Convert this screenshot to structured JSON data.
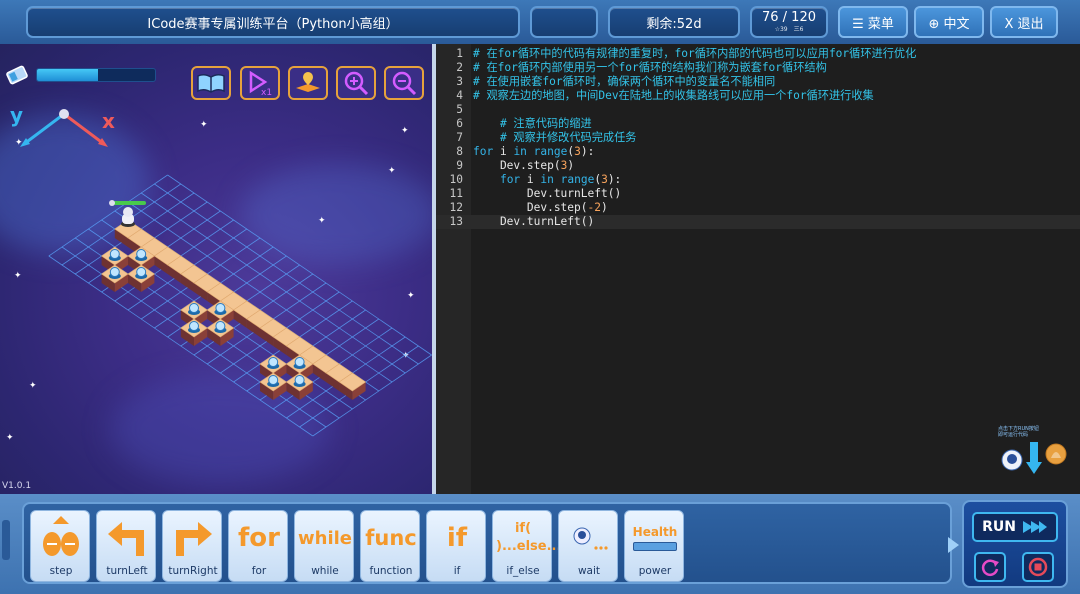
{
  "header": {
    "title": "ICode赛事专属训练平台（Python小高组）",
    "remaining": "剩余:52d",
    "progress": "76 / 120",
    "progress_sub_a": "☆39",
    "progress_sub_b": "三6",
    "menu_label": "☰ 菜单",
    "lang_label": "⊕ 中文",
    "exit_label": "X 退出"
  },
  "scene": {
    "axis_y": "y",
    "axis_x": "x",
    "version": "V1.0.1",
    "energy_level": 0.52,
    "tools": [
      "book-icon",
      "replay-x1-icon",
      "map-icon",
      "zoom-in-icon",
      "zoom-out-icon"
    ]
  },
  "editor": {
    "lines": [
      {
        "n": "1",
        "text": "# 在for循环中的代码有规律的重复时，for循环内部的代码也可以应用for循环进行优化"
      },
      {
        "n": "2",
        "text": "# 在for循环内部使用另一个for循环的结构我们称为嵌套for循环结构"
      },
      {
        "n": "3",
        "text": "# 在使用嵌套for循环时，确保两个循环中的变量名不能相同"
      },
      {
        "n": "4",
        "text": "# 观察左边的地图，中间Dev在陆地上的收集路线可以应用一个for循环进行收集"
      },
      {
        "n": "5",
        "text": ""
      },
      {
        "n": "6",
        "text": "    # 注意代码的缩进"
      },
      {
        "n": "7",
        "text": "    # 观察并修改代码完成任务"
      },
      {
        "n": "8",
        "text": "for i in range(3):"
      },
      {
        "n": "9",
        "text": "    Dev.step(3)"
      },
      {
        "n": "10",
        "text": "    for i in range(3):"
      },
      {
        "n": "11",
        "text": "        Dev.turnLeft()"
      },
      {
        "n": "12",
        "text": "        Dev.step(-2)"
      },
      {
        "n": "13",
        "text": "    Dev.turnLeft()"
      }
    ],
    "tip": "点击下方RUN按钮即可运行代码"
  },
  "blocks": [
    {
      "label": "step",
      "art": "step"
    },
    {
      "label": "turnLeft",
      "art": "turnLeft"
    },
    {
      "label": "turnRight",
      "art": "turnRight"
    },
    {
      "label": "for",
      "art": "for"
    },
    {
      "label": "while",
      "art": "while"
    },
    {
      "label": "function",
      "art": "func"
    },
    {
      "label": "if",
      "art": "if"
    },
    {
      "label": "if_else",
      "art": "if( )...else..."
    },
    {
      "label": "wait",
      "art": "wait"
    },
    {
      "label": "power",
      "art": "Health"
    }
  ],
  "run": {
    "label": "RUN"
  },
  "colors": {
    "accent": "#3fb8f0",
    "orange": "#f4992c",
    "comment": "#33c3e8"
  }
}
